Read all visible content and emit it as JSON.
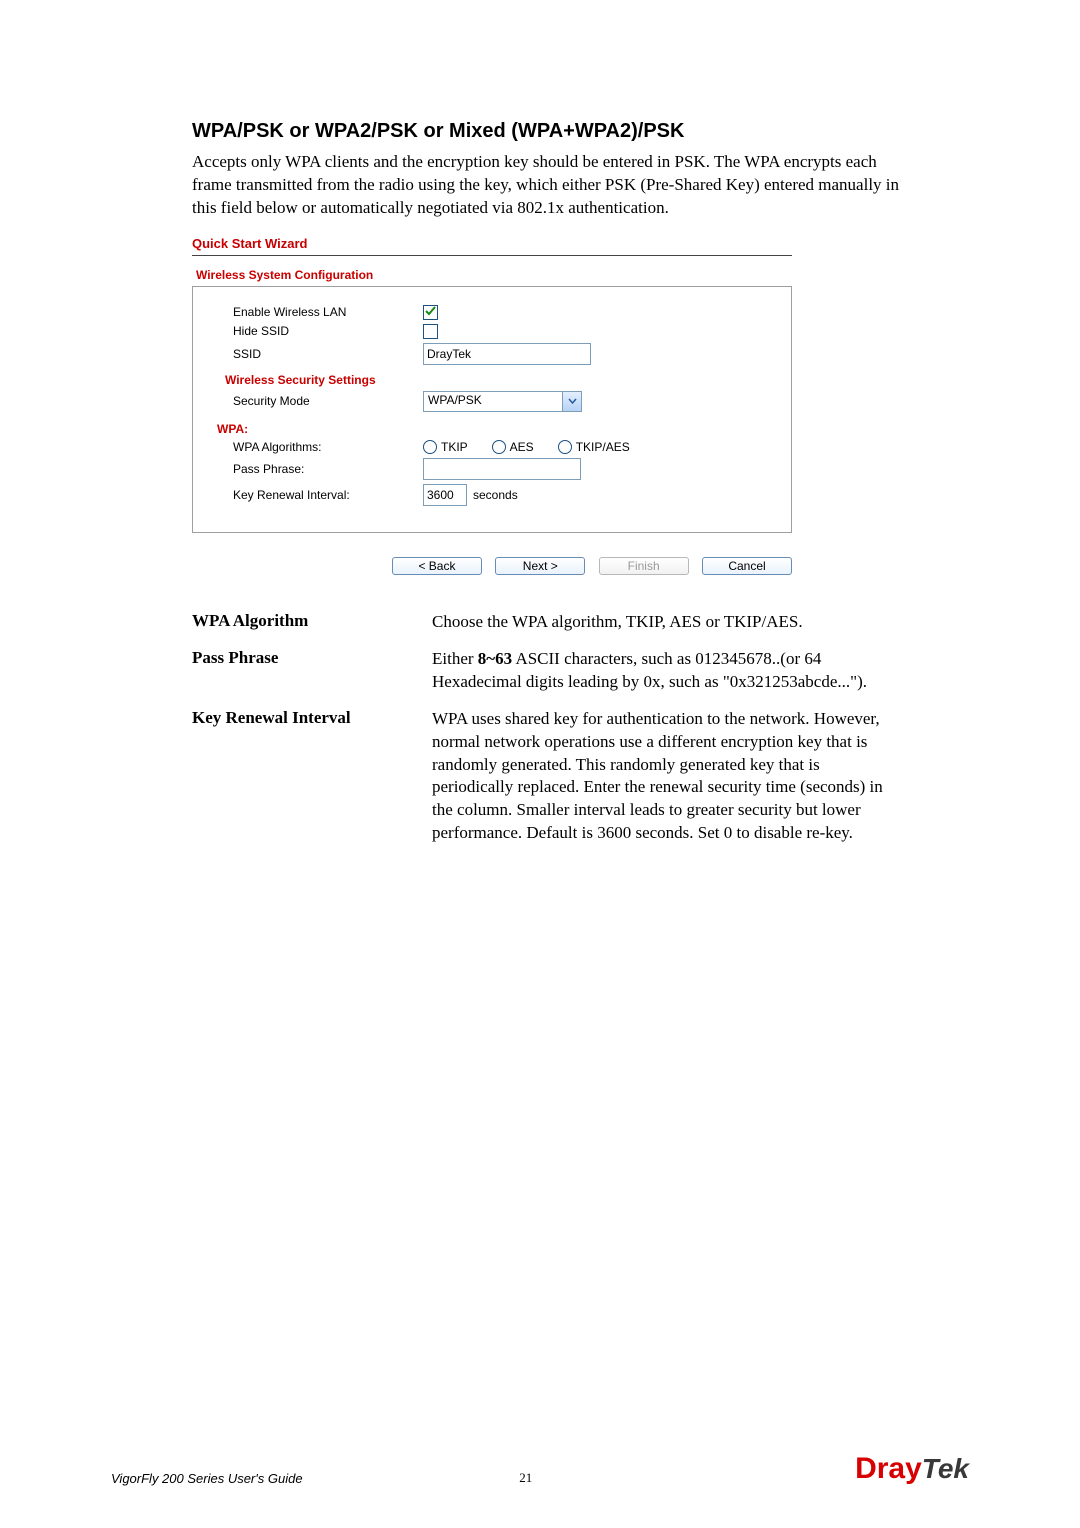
{
  "section_heading": "WPA/PSK or WPA2/PSK or Mixed (WPA+WPA2)/PSK",
  "intro_paragraph": "Accepts only WPA clients and the encryption key should be entered in PSK. The WPA encrypts each frame transmitted from the radio using the key, which either PSK (Pre-Shared Key) entered manually in this field below or automatically negotiated via 802.1x authentication.",
  "screenshot": {
    "wizard_title": "Quick Start Wizard",
    "panel_title": "Wireless System Configuration",
    "enable_wlan_label": "Enable Wireless LAN",
    "enable_wlan_checked": true,
    "hide_ssid_label": "Hide SSID",
    "hide_ssid_checked": false,
    "ssid_label": "SSID",
    "ssid_value": "DrayTek",
    "security_settings_header": "Wireless Security Settings",
    "security_mode_label": "Security Mode",
    "security_mode_value": "WPA/PSK",
    "wpa_header": "WPA:",
    "wpa_algorithms_label": "WPA Algorithms:",
    "wpa_algo_options": [
      "TKIP",
      "AES",
      "TKIP/AES"
    ],
    "pass_phrase_label": "Pass Phrase:",
    "pass_phrase_value": "",
    "key_renewal_label": "Key Renewal Interval:",
    "key_renewal_value": "3600",
    "key_renewal_unit": "seconds",
    "nav": {
      "back": "< Back",
      "next": "Next >",
      "finish": "Finish",
      "cancel": "Cancel"
    }
  },
  "definitions": [
    {
      "term": "WPA Algorithm",
      "desc_pre": "Choose the WPA algorithm, TKIP, AES or TKIP/AES.",
      "bold": "",
      "desc_post": ""
    },
    {
      "term": "Pass Phrase",
      "desc_pre": "Either ",
      "bold": "8~63",
      "desc_post": " ASCII characters, such as 012345678..(or 64 Hexadecimal digits leading by 0x, such as \"0x321253abcde...\")."
    },
    {
      "term": "Key Renewal Interval",
      "desc_pre": "WPA uses shared key for authentication to the network. However, normal network operations use a different encryption key that is randomly generated. This randomly generated key that is periodically replaced. Enter the renewal security time (seconds) in the column. Smaller interval leads to greater security but lower performance. Default is 3600 seconds. Set 0 to disable re-key.",
      "bold": "",
      "desc_post": ""
    }
  ],
  "footer": {
    "guide": "VigorFly 200 Series User's Guide",
    "page_number": "21",
    "brand_left": "Dray",
    "brand_right": "Tek"
  }
}
